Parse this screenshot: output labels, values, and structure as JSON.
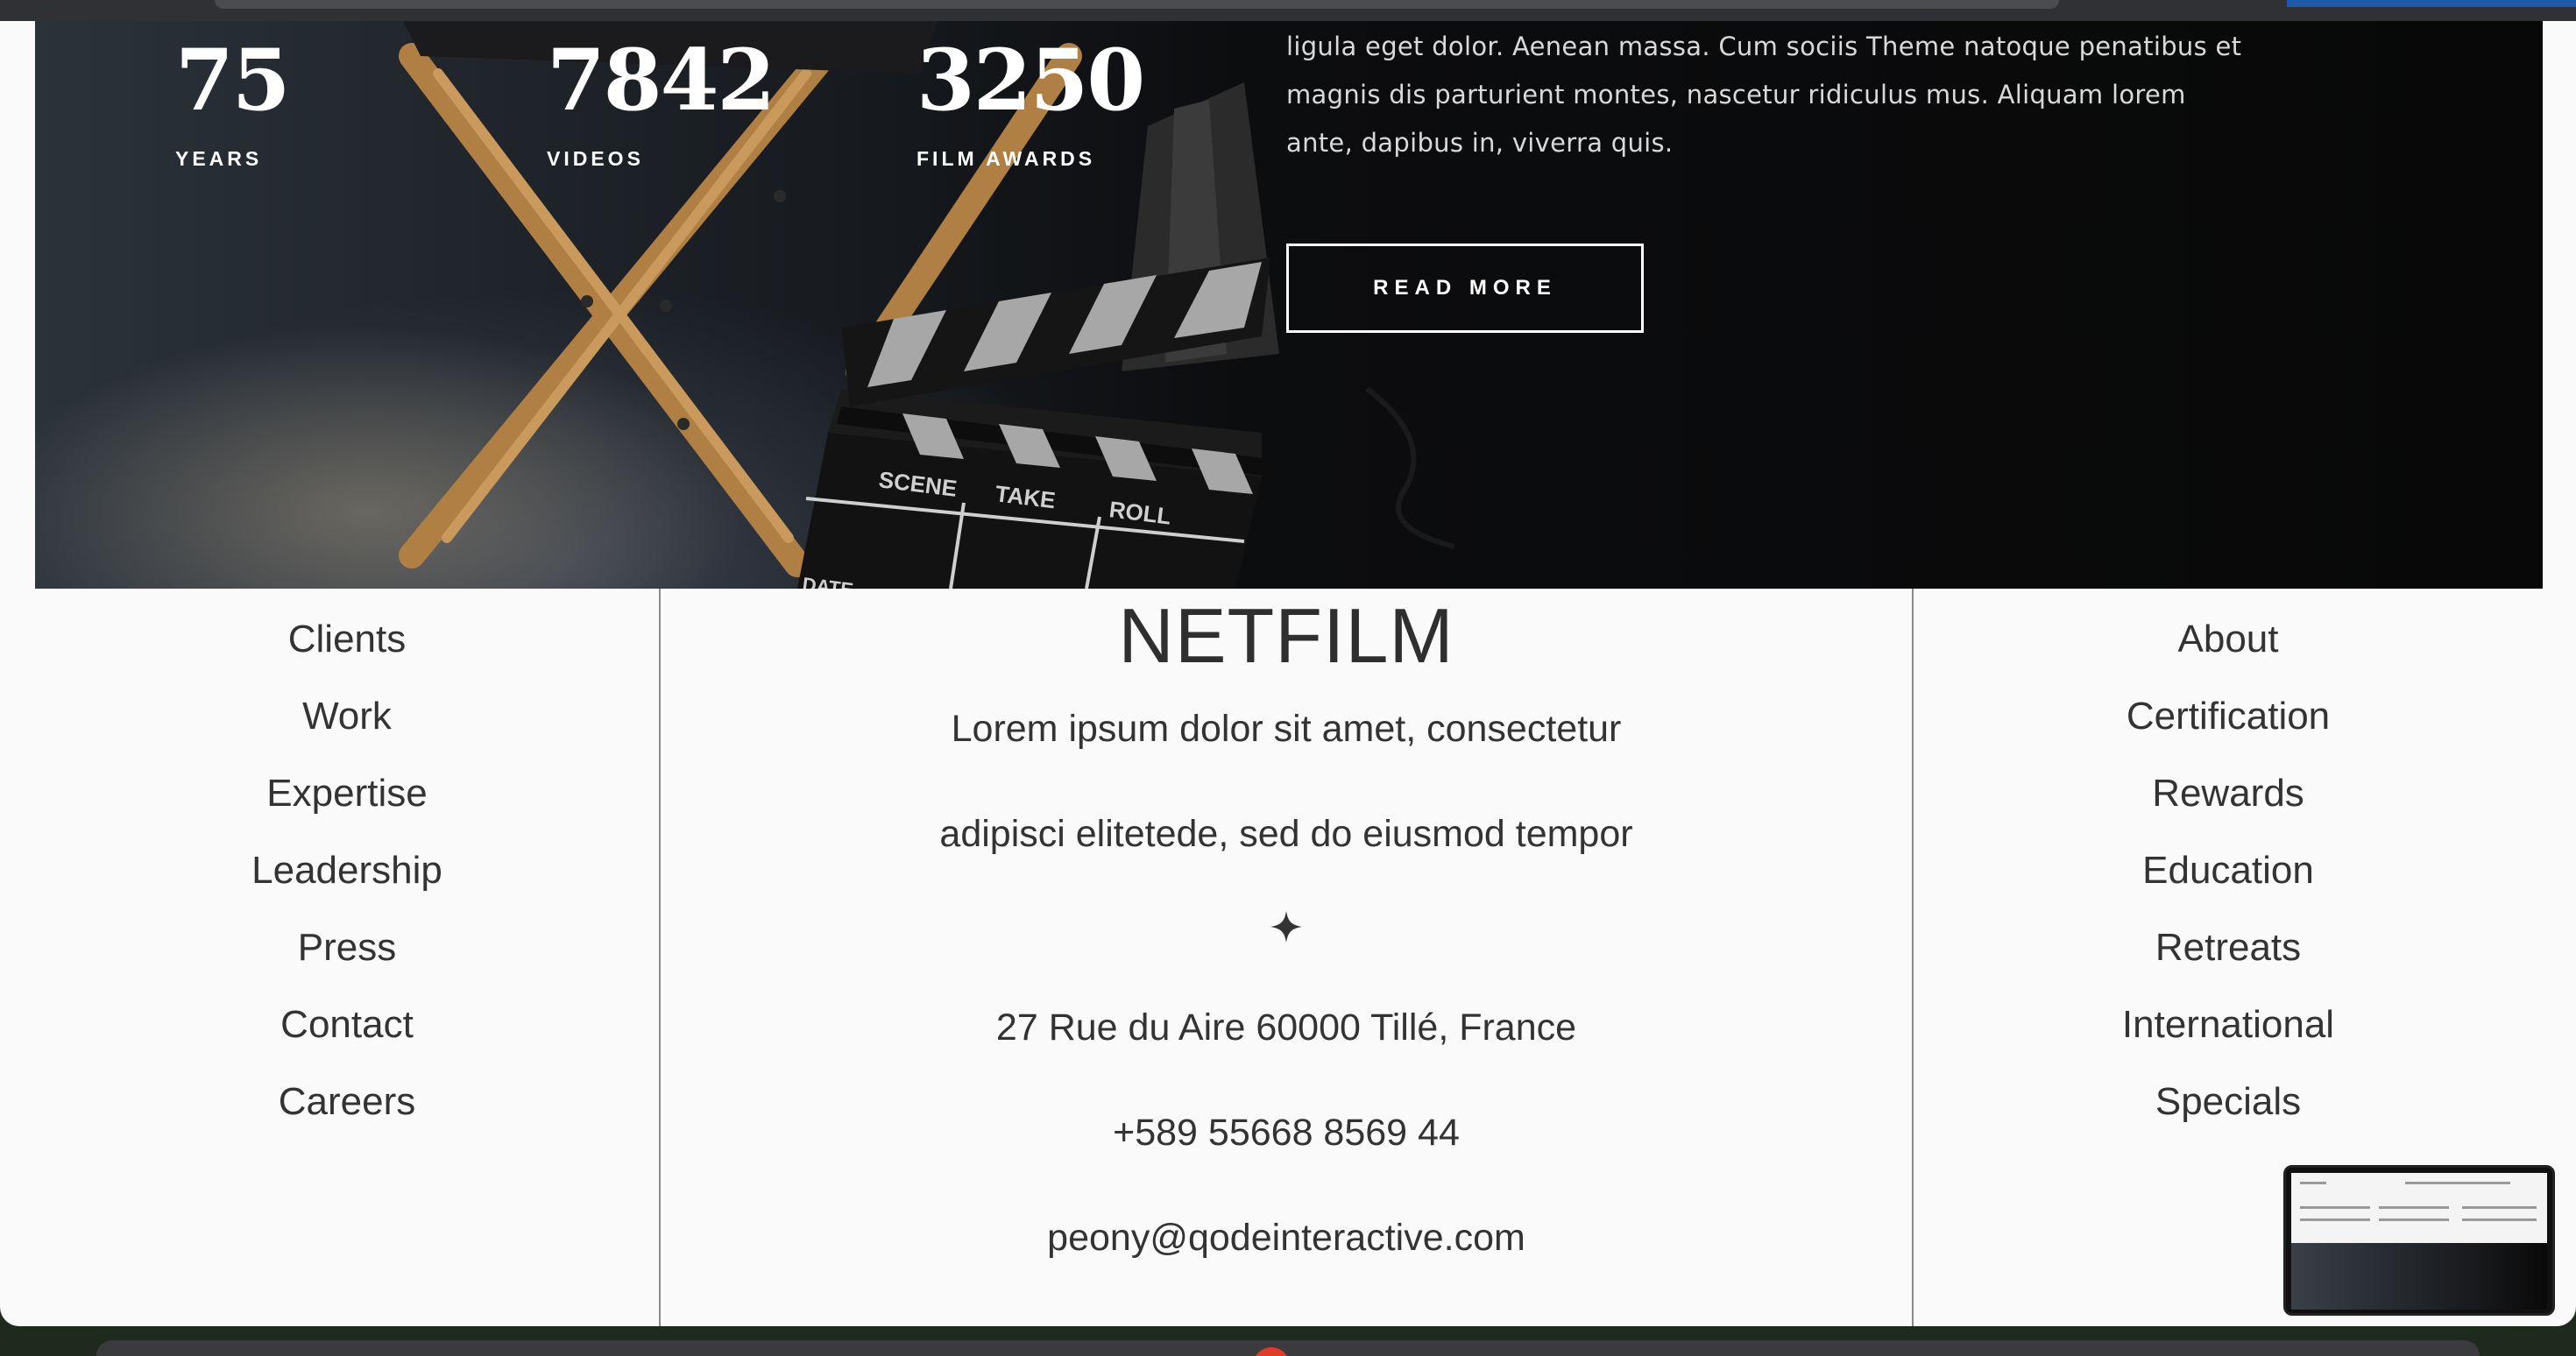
{
  "hero": {
    "stats": [
      {
        "value": "75",
        "label": "YEARS"
      },
      {
        "value": "7842",
        "label": "VIDEOS"
      },
      {
        "value": "3250",
        "label": "FILM AWARDS"
      }
    ],
    "text": "ligula eget dolor. Aenean massa. Cum sociis Theme natoque penatibus et magnis dis parturient montes, nascetur ridiculus mus. Aliquam lorem ante, dapibus in, viverra quis.",
    "button_label": "READ MORE",
    "clapper": {
      "scene": "SCENE",
      "take": "TAKE",
      "roll": "ROLL",
      "date": "DATE"
    }
  },
  "footer": {
    "left_links": [
      "Clients",
      "Work",
      "Expertise",
      "Leadership",
      "Press",
      "Contact",
      "Careers"
    ],
    "right_links": [
      "About",
      "Certification",
      "Rewards",
      "Education",
      "Retreats",
      "International",
      "Specials"
    ],
    "brand": "NETFILM",
    "tagline_line1": "Lorem ipsum dolor sit amet, consectetur",
    "tagline_line2": "adipisci elitetede, sed do eiusmod tempor",
    "star_icon": "sparkle-icon",
    "address": "27 Rue du Aire 60000 Tillé, France",
    "phone": "+589 55668 8569 44",
    "email": "peony@qodeinteractive.com"
  }
}
